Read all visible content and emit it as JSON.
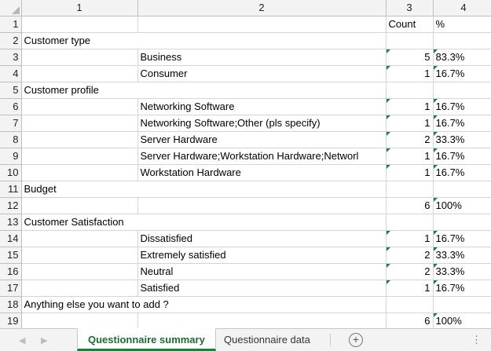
{
  "columns": [
    "1",
    "2",
    "3",
    "4"
  ],
  "rows": [
    {
      "n": "1",
      "a": "",
      "b": "",
      "c": "Count",
      "d": "%",
      "fc": false,
      "fd": false,
      "nc": false
    },
    {
      "n": "2",
      "a": "Customer type",
      "b": "",
      "c": "",
      "d": "",
      "fc": false,
      "fd": false,
      "nc": false
    },
    {
      "n": "3",
      "a": "",
      "b": "Business",
      "c": "5",
      "d": "83.3%",
      "fc": true,
      "fd": true,
      "nc": true
    },
    {
      "n": "4",
      "a": "",
      "b": "Consumer",
      "c": "1",
      "d": "16.7%",
      "fc": true,
      "fd": true,
      "nc": true
    },
    {
      "n": "5",
      "a": "Customer profile",
      "b": "",
      "c": "",
      "d": "",
      "fc": false,
      "fd": false,
      "nc": false
    },
    {
      "n": "6",
      "a": "",
      "b": "Networking Software",
      "c": "1",
      "d": "16.7%",
      "fc": true,
      "fd": true,
      "nc": true
    },
    {
      "n": "7",
      "a": "",
      "b": "Networking Software;Other (pls specify)",
      "c": "1",
      "d": "16.7%",
      "fc": true,
      "fd": true,
      "nc": true
    },
    {
      "n": "8",
      "a": "",
      "b": "Server Hardware",
      "c": "2",
      "d": "33.3%",
      "fc": true,
      "fd": true,
      "nc": true
    },
    {
      "n": "9",
      "a": "",
      "b": "Server Hardware;Workstation Hardware;Networl",
      "c": "1",
      "d": "16.7%",
      "fc": true,
      "fd": true,
      "nc": true
    },
    {
      "n": "10",
      "a": "",
      "b": "Workstation Hardware",
      "c": "1",
      "d": "16.7%",
      "fc": true,
      "fd": true,
      "nc": true
    },
    {
      "n": "11",
      "a": "Budget",
      "b": "",
      "c": "",
      "d": "",
      "fc": false,
      "fd": false,
      "nc": false
    },
    {
      "n": "12",
      "a": "",
      "b": "",
      "c": "6",
      "d": "100%",
      "fc": false,
      "fd": true,
      "nc": true
    },
    {
      "n": "13",
      "a": "Customer Satisfaction",
      "b": "",
      "c": "",
      "d": "",
      "fc": false,
      "fd": false,
      "nc": false
    },
    {
      "n": "14",
      "a": "",
      "b": "Dissatisfied",
      "c": "1",
      "d": "16.7%",
      "fc": true,
      "fd": true,
      "nc": true
    },
    {
      "n": "15",
      "a": "",
      "b": "Extremely satisfied",
      "c": "2",
      "d": "33.3%",
      "fc": true,
      "fd": true,
      "nc": true
    },
    {
      "n": "16",
      "a": "",
      "b": "Neutral",
      "c": "2",
      "d": "33.3%",
      "fc": true,
      "fd": true,
      "nc": true
    },
    {
      "n": "17",
      "a": "",
      "b": "Satisfied",
      "c": "1",
      "d": "16.7%",
      "fc": true,
      "fd": true,
      "nc": true
    },
    {
      "n": "18",
      "a": "Anything else you want to add ?",
      "b": "",
      "c": "",
      "d": "",
      "fc": false,
      "fd": false,
      "nc": false
    },
    {
      "n": "19",
      "a": "",
      "b": "",
      "c": "6",
      "d": "100%",
      "fc": false,
      "fd": true,
      "nc": true
    },
    {
      "n": "",
      "a": "",
      "b": "",
      "c": "",
      "d": "",
      "fc": false,
      "fd": false,
      "nc": false
    }
  ],
  "tabs": [
    {
      "label": "Questionnaire summary",
      "active": true
    },
    {
      "label": "Questionnaire data",
      "active": false
    }
  ],
  "icons": {
    "prev": "chevron-left-icon",
    "next": "chevron-right-icon",
    "add": "add-sheet-icon",
    "more": "more-icon"
  },
  "colors": {
    "accent": "#1e7d3a",
    "header_bg": "#f3f3f3"
  }
}
